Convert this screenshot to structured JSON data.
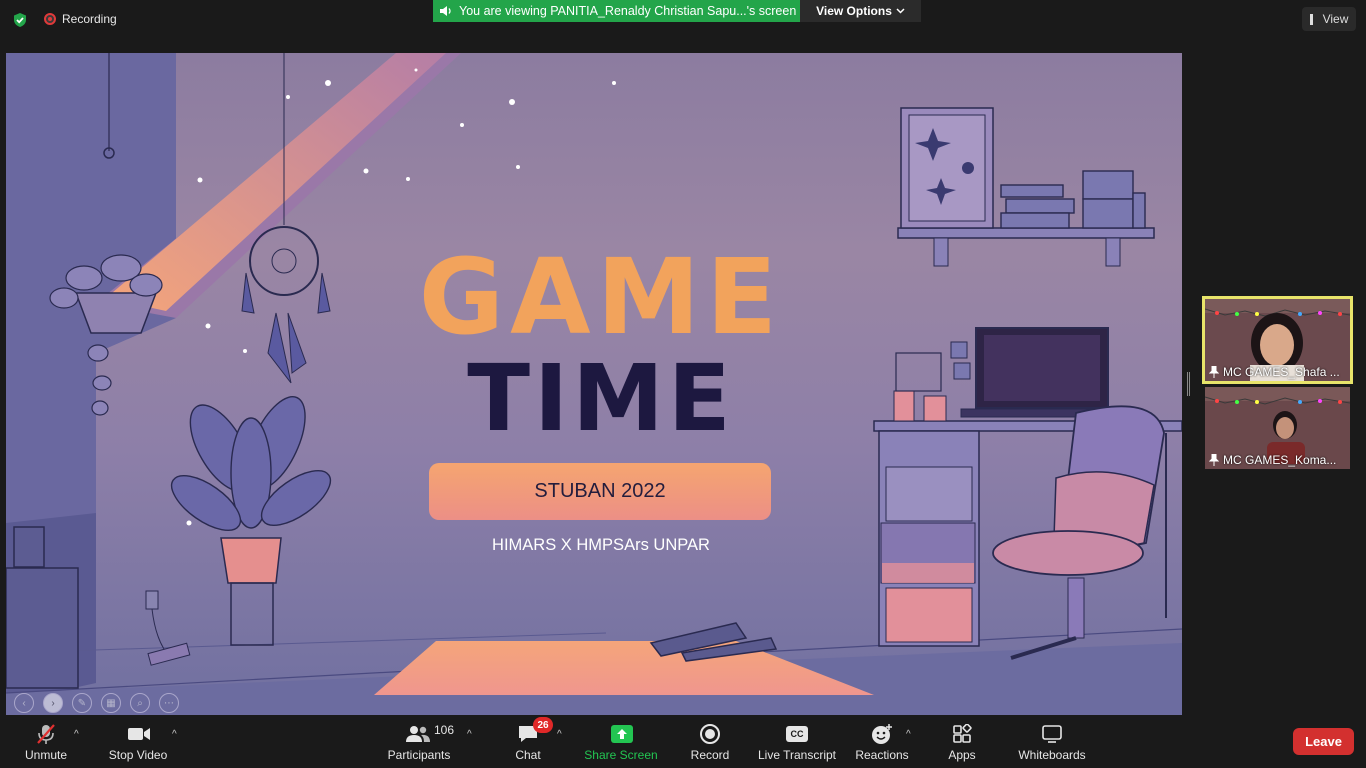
{
  "topbar": {
    "recording_label": "Recording",
    "viewing_banner": "You are viewing PANITIA_Renaldy Christian Sapu...'s screen",
    "view_options_label": "View Options",
    "view_label": "View"
  },
  "slide": {
    "title_line1": "GAME",
    "title_line2": "TIME",
    "pill_text": "STUBAN 2022",
    "subtitle": "HIMARS X HMPSArs UNPAR"
  },
  "participants_panel": {
    "tiles": [
      {
        "name": "MC GAMES_Shafa ...",
        "active_speaker": true
      },
      {
        "name": "MC GAMES_Koma...",
        "active_speaker": false
      }
    ]
  },
  "toolbar": {
    "unmute_label": "Unmute",
    "stop_video_label": "Stop Video",
    "participants_label": "Participants",
    "participants_count": "106",
    "chat_label": "Chat",
    "chat_badge": "26",
    "share_screen_label": "Share Screen",
    "record_label": "Record",
    "live_transcript_label": "Live Transcript",
    "live_transcript_icon_text": "CC",
    "reactions_label": "Reactions",
    "apps_label": "Apps",
    "whiteboards_label": "Whiteboards",
    "leave_label": "Leave"
  },
  "colors": {
    "banner_green": "#23a54a",
    "leave_red": "#d3302f",
    "share_green": "#23c552",
    "active_speaker_border": "#e8e46a",
    "slide_title_orange": "#f2a35c",
    "slide_title_navy": "#1d1840"
  },
  "icons": {
    "security": "shield-check-icon",
    "recording": "recording-dot-icon",
    "banner": "speaker-icon",
    "mic": "mic-muted-icon",
    "video": "video-camera-icon",
    "participants": "people-icon",
    "chat": "chat-bubble-icon",
    "share": "share-screen-arrow-icon",
    "record": "record-circle-icon",
    "reactions": "smiley-plus-icon",
    "apps": "apps-grid-icon",
    "whiteboards": "whiteboard-icon"
  }
}
